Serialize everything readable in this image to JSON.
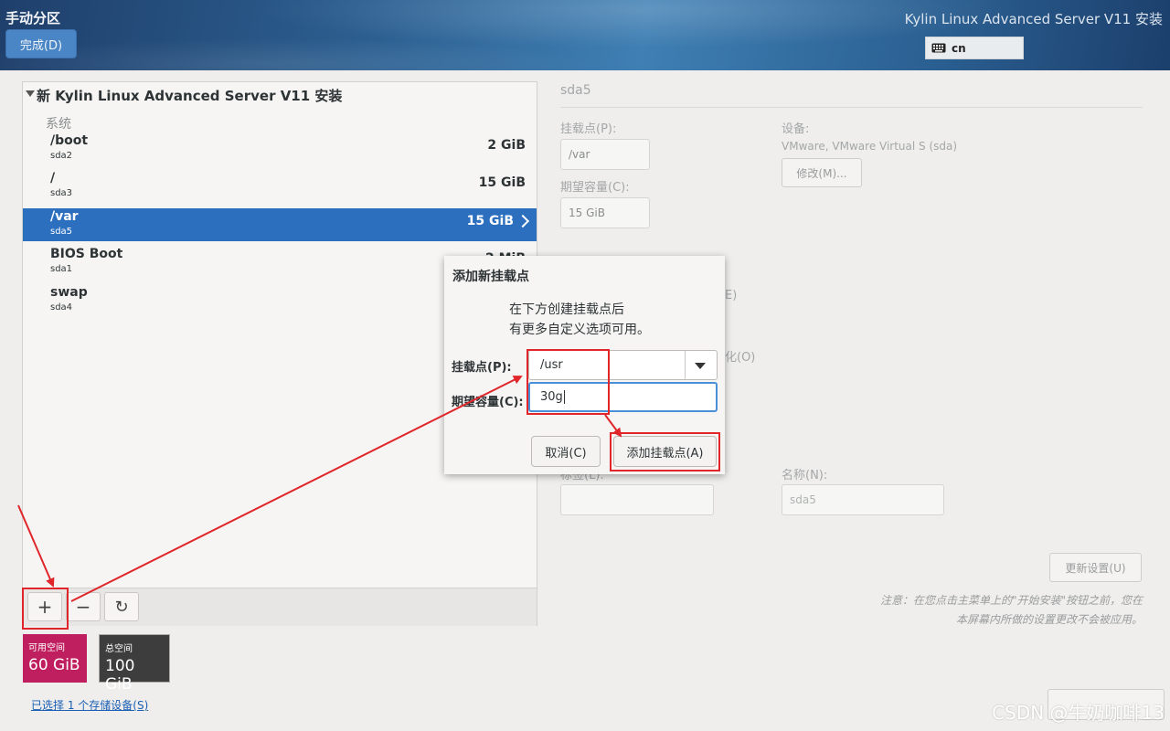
{
  "header": {
    "page_title": "手动分区",
    "done_button": "完成(D)",
    "product_title": "Kylin Linux Advanced Server V11 安装",
    "keyboard_layout": "cn"
  },
  "left_panel": {
    "install_title": "新 Kylin Linux Advanced Server V11 安装",
    "group_label": "系统",
    "partitions": [
      {
        "mount": "/boot",
        "device": "sda2",
        "size": "2 GiB"
      },
      {
        "mount": "/",
        "device": "sda3",
        "size": "15 GiB"
      },
      {
        "mount": "/var",
        "device": "sda5",
        "size": "15 GiB"
      },
      {
        "mount": "BIOS Boot",
        "device": "sda1",
        "size": "2 MiB"
      },
      {
        "mount": "swap",
        "device": "sda4",
        "size": ""
      }
    ],
    "toolbar": {
      "add_icon": "+",
      "remove_icon": "−",
      "refresh_icon": "↻"
    },
    "available_space": {
      "label": "可用空间",
      "value": "60 GiB",
      "color": "#c01f5f"
    },
    "total_space": {
      "label": "总空间",
      "value": "100 GiB",
      "color": "#3d3d3d"
    },
    "storage_link": "已选择 1 个存储设备(S)"
  },
  "right_panel": {
    "section_title": "sda5",
    "mount_point_label": "挂载点(P):",
    "mount_point_value": "/var",
    "capacity_label": "期望容量(C):",
    "capacity_value": "15 GiB",
    "device_label": "设备:",
    "device_value": "VMware, VMware Virtual S (sda)",
    "modify_button": "修改(M)...",
    "partial_text_1": "E)",
    "partial_text_2": "化(O)",
    "label_label": "标签(L):",
    "name_label": "名称(N):",
    "name_value": "sda5",
    "update_button": "更新设置(U)",
    "note_line1": "注意：在您点击主菜单上的\"开始安装\"按钮之前，您在",
    "note_line2": "本屏幕内所做的设置更改不会被应用。"
  },
  "modal": {
    "title": "添加新挂载点",
    "desc_line1": "在下方创建挂载点后",
    "desc_line2": "有更多自定义选项可用。",
    "mount_point_label": "挂载点(P):",
    "mount_point_value": "/usr",
    "capacity_label": "期望容量(C):",
    "capacity_value": "30g",
    "cancel_button": "取消(C)",
    "add_button": "添加挂载点(A)"
  },
  "watermark": "CSDN @牛奶咖啡13",
  "colors": {
    "selection": "#2c6fbf",
    "annotation": "#e0262b",
    "focus": "#4a90d9"
  }
}
